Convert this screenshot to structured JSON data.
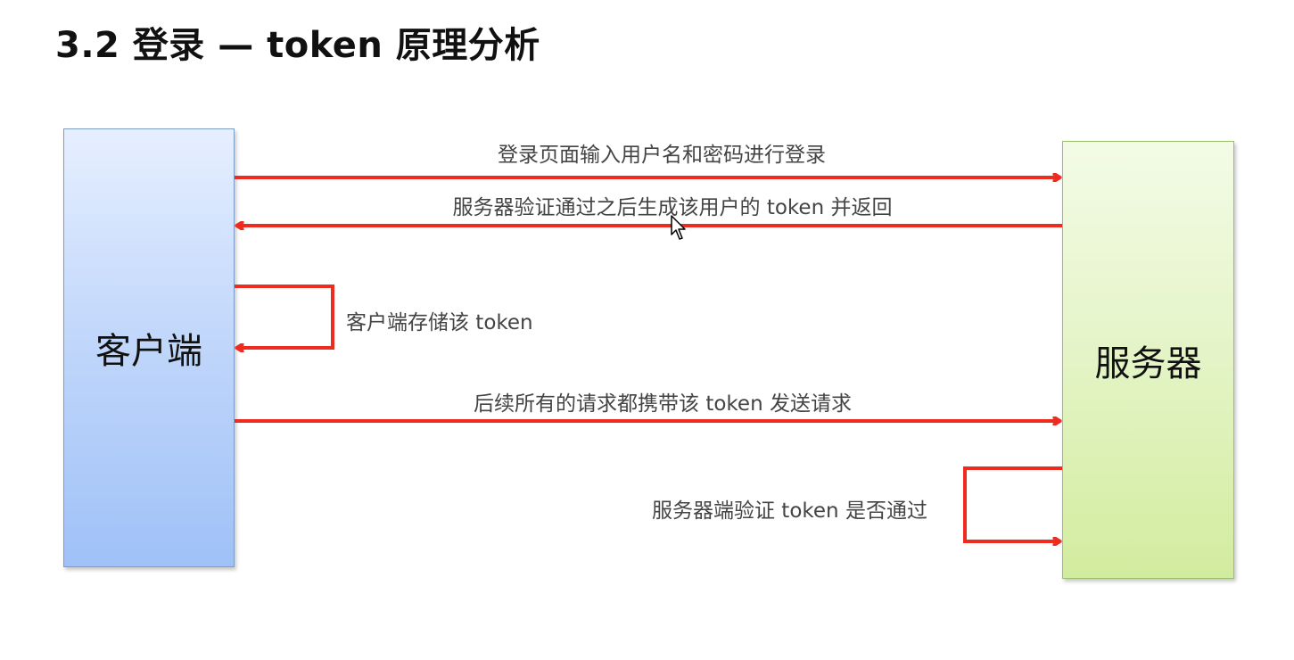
{
  "slide": {
    "title": "3.2 登录 — token 原理分析"
  },
  "actors": {
    "client": "客户端",
    "server": "服务器"
  },
  "messages": {
    "login": "登录页面输入用户名和密码进行登录",
    "server_returns_token": "服务器验证通过之后生成该用户的 token 并返回",
    "client_stores_token": "客户端存储该 token",
    "requests_carry_token": "后续所有的请求都携带该 token 发送请求",
    "server_verifies_token": "服务器端验证 token 是否通过"
  },
  "colors": {
    "arrow": "#ee2b1f",
    "client_fill": "#b7d0f9",
    "server_fill": "#e0f2c0"
  },
  "icons": {
    "cursor": "mouse-pointer-icon"
  }
}
